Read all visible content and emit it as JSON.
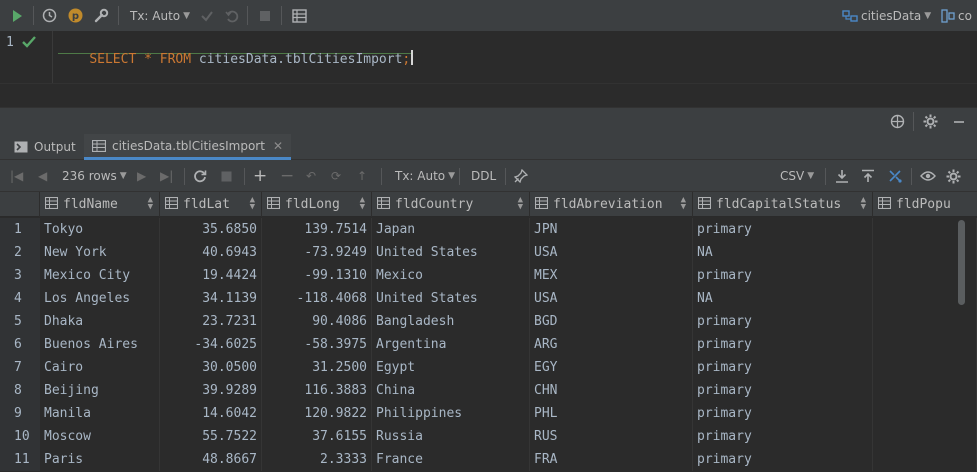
{
  "toolbar": {
    "tx_mode": "Tx: Auto",
    "datasource": "citiesData",
    "connection_partial": "co"
  },
  "editor": {
    "line_number": "1",
    "query_tokens": [
      {
        "t": "SELECT",
        "k": "kw"
      },
      {
        "t": " * ",
        "k": "kw"
      },
      {
        "t": "FROM",
        "k": "kw"
      },
      {
        "t": " citiesData.tblCitiesImport",
        "k": "ident"
      },
      {
        "t": ";",
        "k": "kw"
      }
    ]
  },
  "tabs": {
    "output_label": "Output",
    "result_label": "citiesData.tblCitiesImport"
  },
  "grid_toolbar": {
    "rows_label": "236 rows",
    "tx_mode": "Tx: Auto",
    "ddl_label": "DDL",
    "export_format": "CSV"
  },
  "columns": [
    "fldName",
    "fldLat",
    "fldLong",
    "fldCountry",
    "fldAbreviation",
    "fldCapitalStatus",
    "fldPopu"
  ],
  "rows": [
    {
      "n": "1",
      "name": "Tokyo",
      "lat": "35.6850",
      "long": "139.7514",
      "country": "Japan",
      "abbr": "JPN",
      "cap": "primary"
    },
    {
      "n": "2",
      "name": "New York",
      "lat": "40.6943",
      "long": "-73.9249",
      "country": "United States",
      "abbr": "USA",
      "cap": "NA"
    },
    {
      "n": "3",
      "name": "Mexico City",
      "lat": "19.4424",
      "long": "-99.1310",
      "country": "Mexico",
      "abbr": "MEX",
      "cap": "primary"
    },
    {
      "n": "4",
      "name": "Los Angeles",
      "lat": "34.1139",
      "long": "-118.4068",
      "country": "United States",
      "abbr": "USA",
      "cap": "NA"
    },
    {
      "n": "5",
      "name": "Dhaka",
      "lat": "23.7231",
      "long": "90.4086",
      "country": "Bangladesh",
      "abbr": "BGD",
      "cap": "primary"
    },
    {
      "n": "6",
      "name": "Buenos Aires",
      "lat": "-34.6025",
      "long": "-58.3975",
      "country": "Argentina",
      "abbr": "ARG",
      "cap": "primary"
    },
    {
      "n": "7",
      "name": "Cairo",
      "lat": "30.0500",
      "long": "31.2500",
      "country": "Egypt",
      "abbr": "EGY",
      "cap": "primary"
    },
    {
      "n": "8",
      "name": "Beijing",
      "lat": "39.9289",
      "long": "116.3883",
      "country": "China",
      "abbr": "CHN",
      "cap": "primary"
    },
    {
      "n": "9",
      "name": "Manila",
      "lat": "14.6042",
      "long": "120.9822",
      "country": "Philippines",
      "abbr": "PHL",
      "cap": "primary"
    },
    {
      "n": "10",
      "name": "Moscow",
      "lat": "55.7522",
      "long": "37.6155",
      "country": "Russia",
      "abbr": "RUS",
      "cap": "primary"
    },
    {
      "n": "11",
      "name": "Paris",
      "lat": "48.8667",
      "long": "2.3333",
      "country": "France",
      "abbr": "FRA",
      "cap": "primary"
    }
  ]
}
